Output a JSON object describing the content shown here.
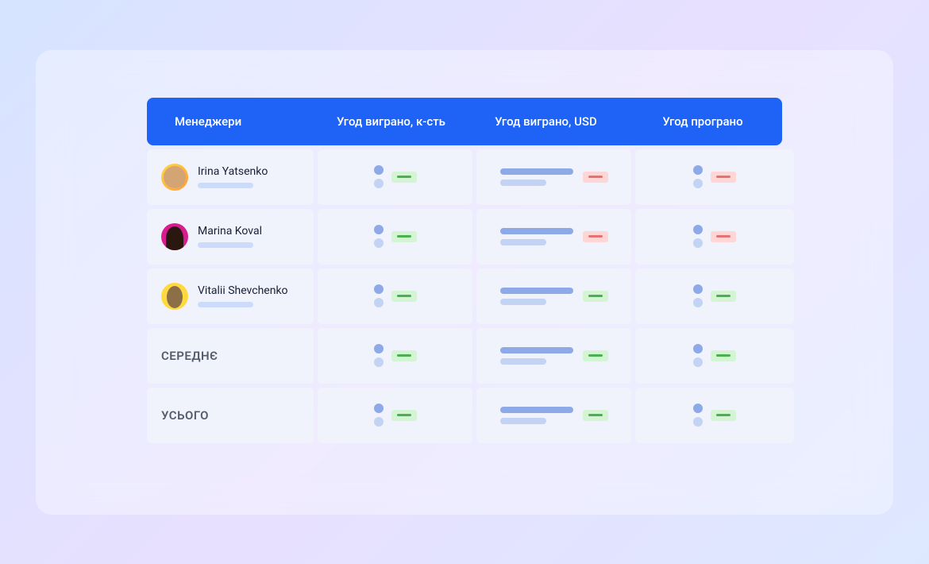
{
  "headers": {
    "managers": "Менеджери",
    "deals_won_count": "Угод виграно, к-сть",
    "deals_won_usd": "Угод виграно, USD",
    "deals_lost": "Угод програно"
  },
  "managers": [
    {
      "name": "Irina Yatsenko",
      "avatar": "avatar-1",
      "deals_won_count_status": "green",
      "deals_won_usd_status": "red",
      "deals_lost_status": "red"
    },
    {
      "name": "Marina Koval",
      "avatar": "avatar-2",
      "deals_won_count_status": "green",
      "deals_won_usd_status": "red",
      "deals_lost_status": "red"
    },
    {
      "name": "Vitalii Shevchenko",
      "avatar": "avatar-3",
      "deals_won_count_status": "green",
      "deals_won_usd_status": "green",
      "deals_lost_status": "green"
    }
  ],
  "summary": {
    "average_label": "СЕРЕДНЄ",
    "total_label": "УСЬОГО"
  }
}
